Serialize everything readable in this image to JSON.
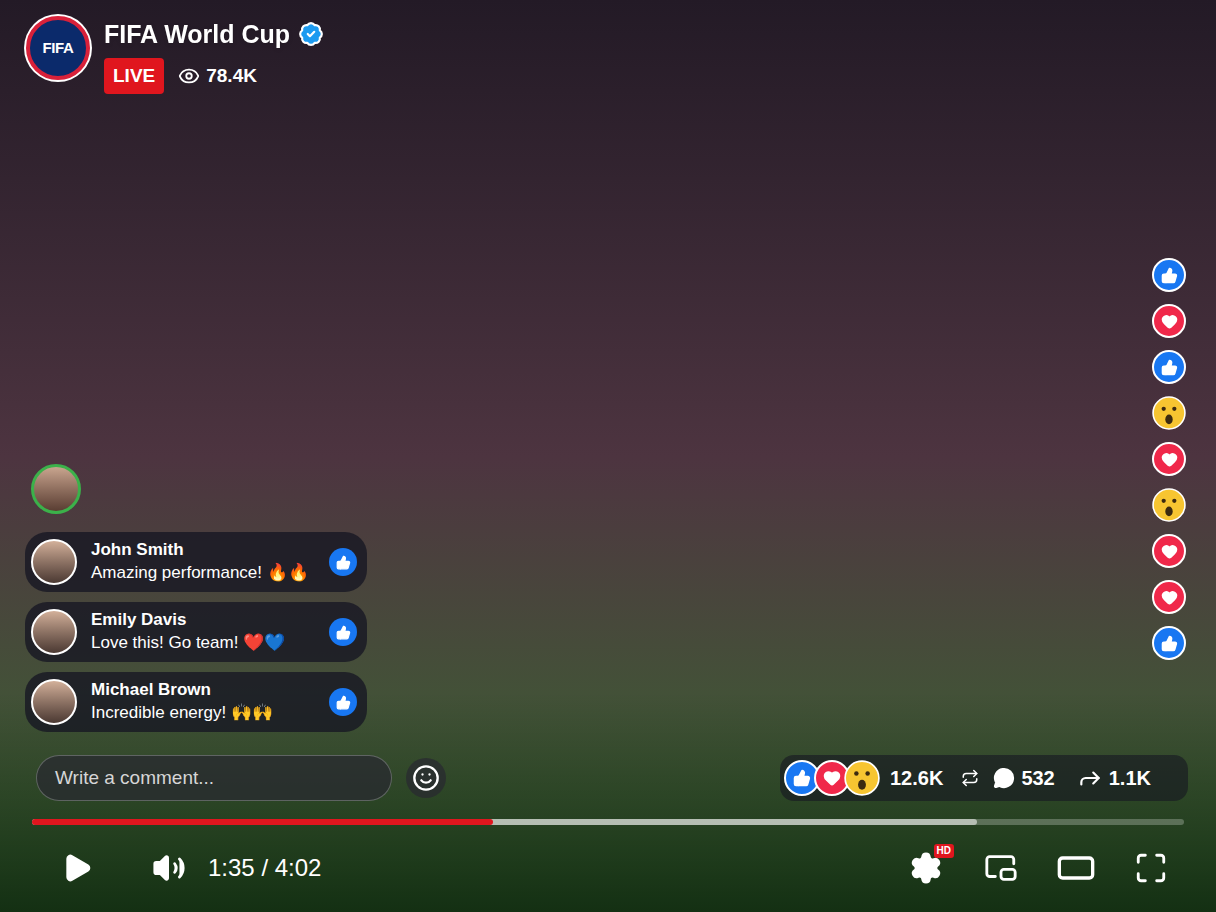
{
  "channel": {
    "logo_text": "FIFA",
    "name": "FIFA World Cup",
    "verified": true
  },
  "live": {
    "badge": "LIVE",
    "viewers": "78.4K"
  },
  "comments": [
    {
      "name": "John Smith",
      "text": "Amazing performance! 🔥🔥"
    },
    {
      "name": "Emily Davis",
      "text": "Love this! Go team! ❤️💙"
    },
    {
      "name": "Michael Brown",
      "text": "Incredible energy! 🙌🙌"
    }
  ],
  "comment_box": {
    "placeholder": "Write a comment..."
  },
  "stats": {
    "reactions": "12.6K",
    "comments": "532",
    "shares": "1.1K"
  },
  "floating_reactions": [
    {
      "kind": "like"
    },
    {
      "kind": "love"
    },
    {
      "kind": "like"
    },
    {
      "kind": "wow"
    },
    {
      "kind": "love"
    },
    {
      "kind": "wow"
    },
    {
      "kind": "love"
    },
    {
      "kind": "love"
    },
    {
      "kind": "like"
    }
  ],
  "player": {
    "paused": true,
    "muted": false,
    "time": "1:35 / 4:02",
    "progress": 0.4,
    "buffered": 0.82,
    "hd_badge": "HD"
  }
}
